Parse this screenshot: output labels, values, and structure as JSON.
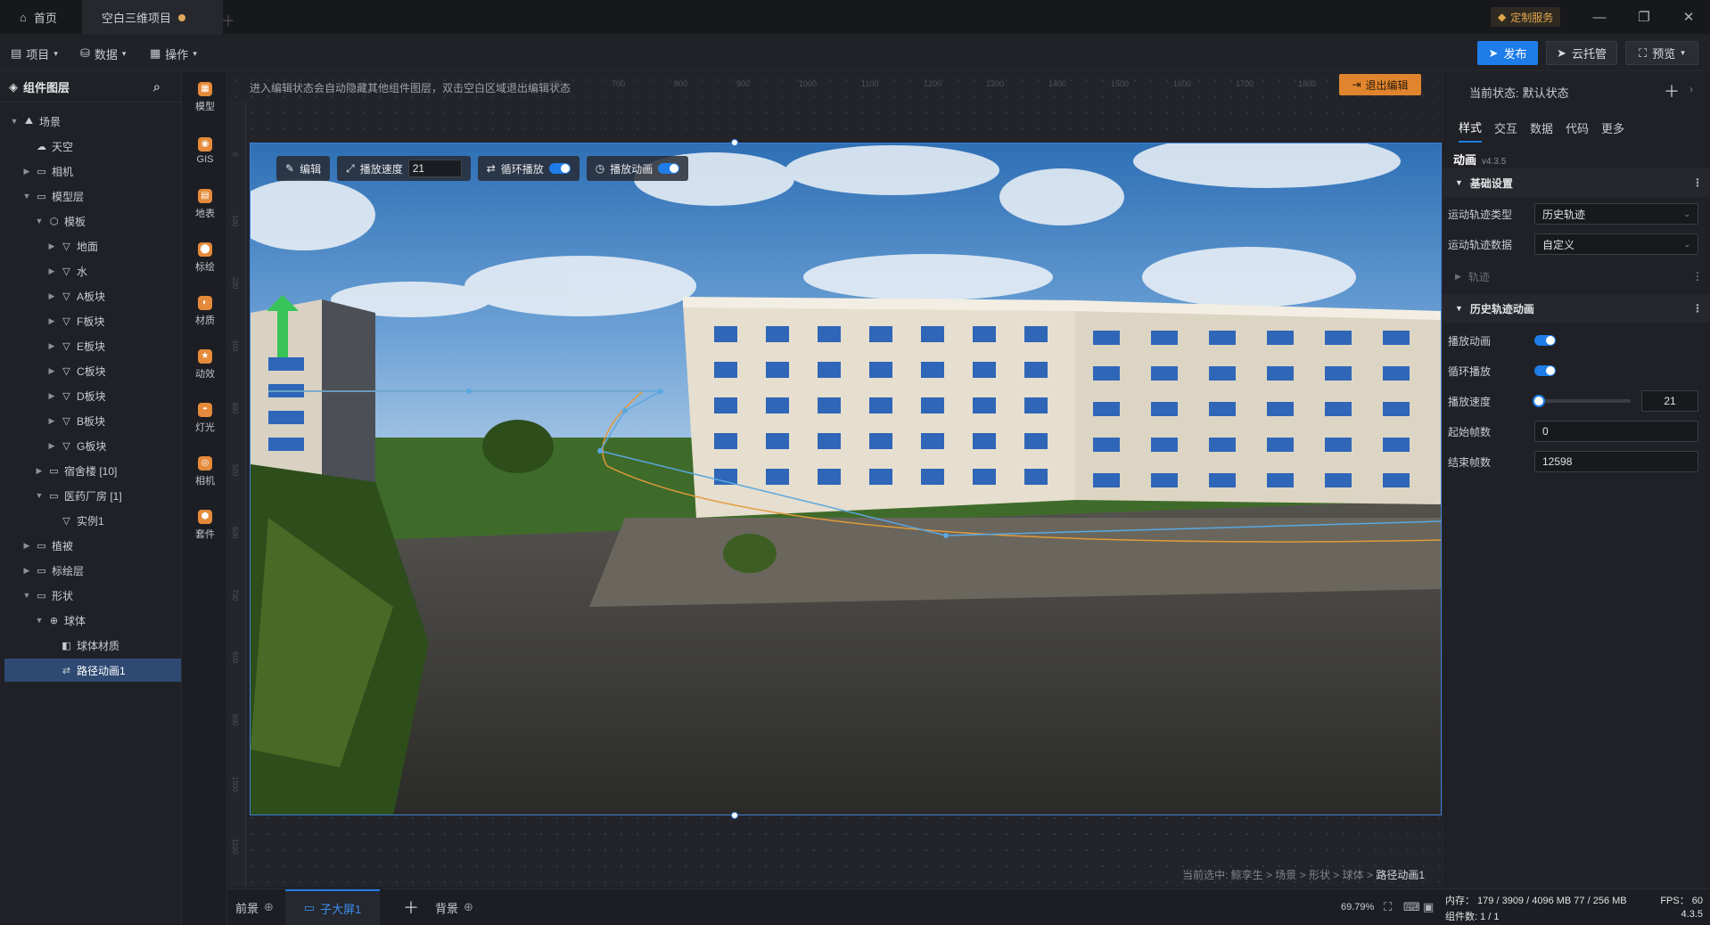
{
  "titlebar": {
    "tabs": [
      {
        "label": "首页"
      },
      {
        "label": "空白三维项目"
      }
    ],
    "custom_service": "定制服务"
  },
  "menubar": {
    "menus": [
      {
        "label": "项目"
      },
      {
        "label": "数据"
      },
      {
        "label": "操作"
      }
    ],
    "publish": "发布",
    "cloud": "云托管",
    "preview": "预览"
  },
  "layers": {
    "title": "组件图层",
    "items": [
      {
        "label": "场景"
      },
      {
        "label": "天空"
      },
      {
        "label": "相机"
      },
      {
        "label": "模型层"
      },
      {
        "label": "模板"
      },
      {
        "label": "地面"
      },
      {
        "label": "水"
      },
      {
        "label": "A板块"
      },
      {
        "label": "F板块"
      },
      {
        "label": "E板块"
      },
      {
        "label": "C板块"
      },
      {
        "label": "D板块"
      },
      {
        "label": "B板块"
      },
      {
        "label": "G板块"
      },
      {
        "label": "宿舍楼 [10]"
      },
      {
        "label": "医药厂房 [1]"
      },
      {
        "label": "实例1"
      },
      {
        "label": "植被"
      },
      {
        "label": "标绘层"
      },
      {
        "label": "形状"
      },
      {
        "label": "球体"
      },
      {
        "label": "球体材质"
      },
      {
        "label": "路径动画1"
      }
    ]
  },
  "tools": [
    {
      "label": "模型"
    },
    {
      "label": "GIS"
    },
    {
      "label": "地表"
    },
    {
      "label": "标绘"
    },
    {
      "label": "材质"
    },
    {
      "label": "动效"
    },
    {
      "label": "灯光"
    },
    {
      "label": "相机"
    },
    {
      "label": "套件"
    }
  ],
  "canvas": {
    "hint": "进入编辑状态会自动隐藏其他组件图层，双击空白区域退出编辑状态",
    "exit_edit": "退出编辑",
    "controls": {
      "edit": "编辑",
      "speed_label": "播放速度",
      "speed_value": "21",
      "loop": "循环播放",
      "play": "播放动画"
    },
    "breadcrumb_prefix": "当前选中: 鲸孪生 > 场景 > 形状 > 球体 > ",
    "breadcrumb_current": "路径动画1",
    "ruler_h": [
      "600",
      "700",
      "800",
      "900",
      "1000",
      "1100",
      "1200",
      "1300",
      "1400",
      "1500",
      "1600",
      "1700",
      "1800"
    ],
    "ruler_v": [
      "0",
      "100",
      "200",
      "300",
      "400",
      "500",
      "600",
      "700",
      "800",
      "900",
      "1000",
      "1100",
      "1200"
    ]
  },
  "bottombar": {
    "foreground": "前景",
    "sub_screen": "子大屏1",
    "background": "背景",
    "zoom": "69.79%"
  },
  "props": {
    "state_label": "当前状态:",
    "state_value": "默认状态",
    "tabs": [
      {
        "label": "样式"
      },
      {
        "label": "交互"
      },
      {
        "label": "数据"
      },
      {
        "label": "代码"
      },
      {
        "label": "更多"
      }
    ],
    "component_name": "动画",
    "version": "v4.3.5",
    "basic_section": "基础设置",
    "track_type_label": "运动轨迹类型",
    "track_type_value": "历史轨迹",
    "track_data_label": "运动轨迹数据",
    "track_data_value": "自定义",
    "track_label": "轨迹",
    "history_section": "历史轨迹动画",
    "play_label": "播放动画",
    "loop_label": "循环播放",
    "speed_label": "播放速度",
    "speed_value": "21",
    "speed_level": 0.05,
    "start_frame_label": "起始帧数",
    "start_frame_value": "0",
    "end_frame_label": "结束帧数",
    "end_frame_value": "12598"
  },
  "status": {
    "memory": "内存： 179 / 3909 / 4096 MB  77 / 256 MB",
    "fps": "FPS： 60",
    "components": "组件数: 1 / 1",
    "version": "4.3.5"
  }
}
